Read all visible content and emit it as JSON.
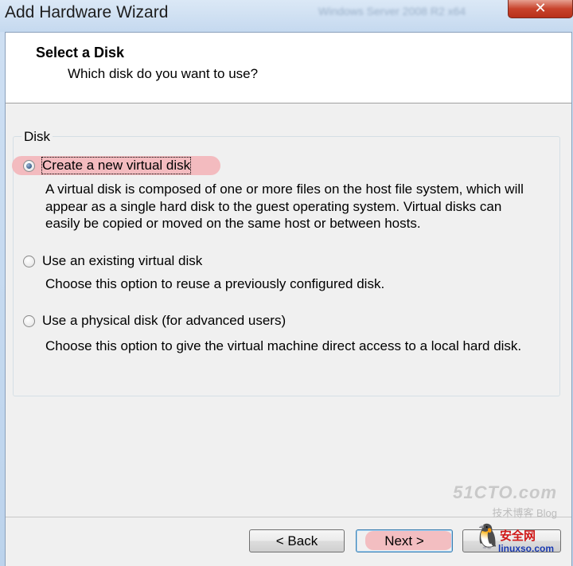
{
  "window": {
    "title": "Add Hardware Wizard",
    "background_title": "Windows Server 2008 R2 x64",
    "close_glyph": "✕"
  },
  "header": {
    "title": "Select a Disk",
    "subtitle": "Which disk do you want to use?"
  },
  "group": {
    "label": "Disk",
    "options": [
      {
        "label": "Create a new virtual disk",
        "checked": true,
        "description": "A virtual disk is composed of one or more files on the host file system, which will appear as a single hard disk to the guest operating system. Virtual disks can easily be copied or moved on the same host or between hosts."
      },
      {
        "label": "Use an existing virtual disk",
        "checked": false,
        "description": "Choose this option to reuse a previously configured disk."
      },
      {
        "label": "Use a physical disk (for advanced users)",
        "checked": false,
        "description": "Choose this option to give the virtual machine direct access to a local hard disk."
      }
    ]
  },
  "buttons": {
    "back": "< Back",
    "next": "Next >"
  },
  "watermark": {
    "site": "51CTO.com",
    "blog": "技术博客 Blog",
    "cn_name": "安全网",
    "url": "linuxso.com",
    "penguin_icon": "🐧"
  },
  "colors": {
    "annotation_highlight": "#f3b5b9",
    "title_bar": "#cfe0f3",
    "close_button": "#c8432c"
  }
}
